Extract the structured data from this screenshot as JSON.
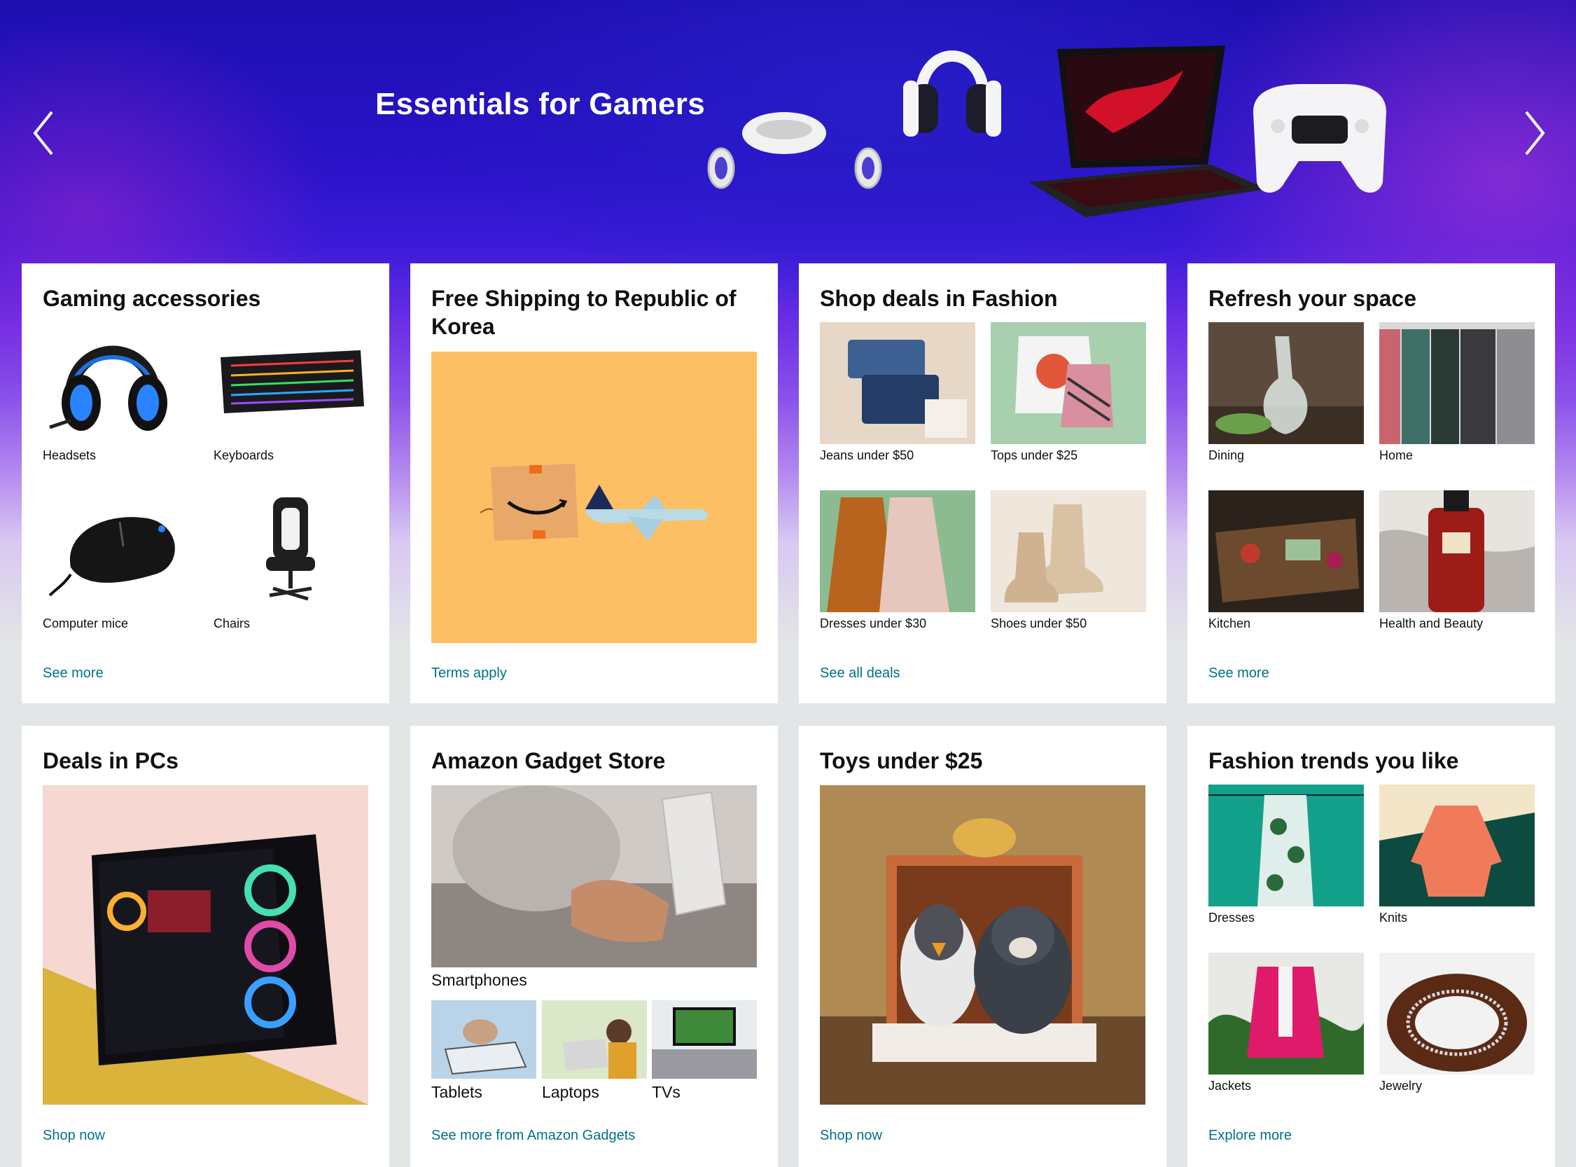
{
  "hero": {
    "title": "Essentials for Gamers",
    "prev_icon": "chevron-left-icon",
    "next_icon": "chevron-right-icon"
  },
  "cards": {
    "gaming": {
      "title": "Gaming accessories",
      "items": [
        "Headsets",
        "Keyboards",
        "Computer mice",
        "Chairs"
      ],
      "link": "See more"
    },
    "shipping": {
      "title": "Free Shipping to Republic of Korea",
      "link": "Terms apply"
    },
    "fashion_deals": {
      "title": "Shop deals in Fashion",
      "items": [
        "Jeans under $50",
        "Tops under $25",
        "Dresses under $30",
        "Shoes under $50"
      ],
      "link": "See all deals"
    },
    "refresh": {
      "title": "Refresh your space",
      "items": [
        "Dining",
        "Home",
        "Kitchen",
        "Health and Beauty"
      ],
      "link": "See more"
    },
    "pcs": {
      "title": "Deals in PCs",
      "link": "Shop now"
    },
    "gadget": {
      "title": "Amazon Gadget Store",
      "main_item": "Smartphones",
      "items": [
        "Tablets",
        "Laptops",
        "TVs"
      ],
      "link": "See more from Amazon Gadgets"
    },
    "toys": {
      "title": "Toys under $25",
      "link": "Shop now"
    },
    "trends": {
      "title": "Fashion trends you like",
      "items": [
        "Dresses",
        "Knits",
        "Jackets",
        "Jewelry"
      ],
      "link": "Explore more"
    }
  },
  "colors": {
    "link": "#007185",
    "text": "#0f1111",
    "page_bg": "#e3e6e6",
    "shipping_bg": "#fdbf63"
  }
}
